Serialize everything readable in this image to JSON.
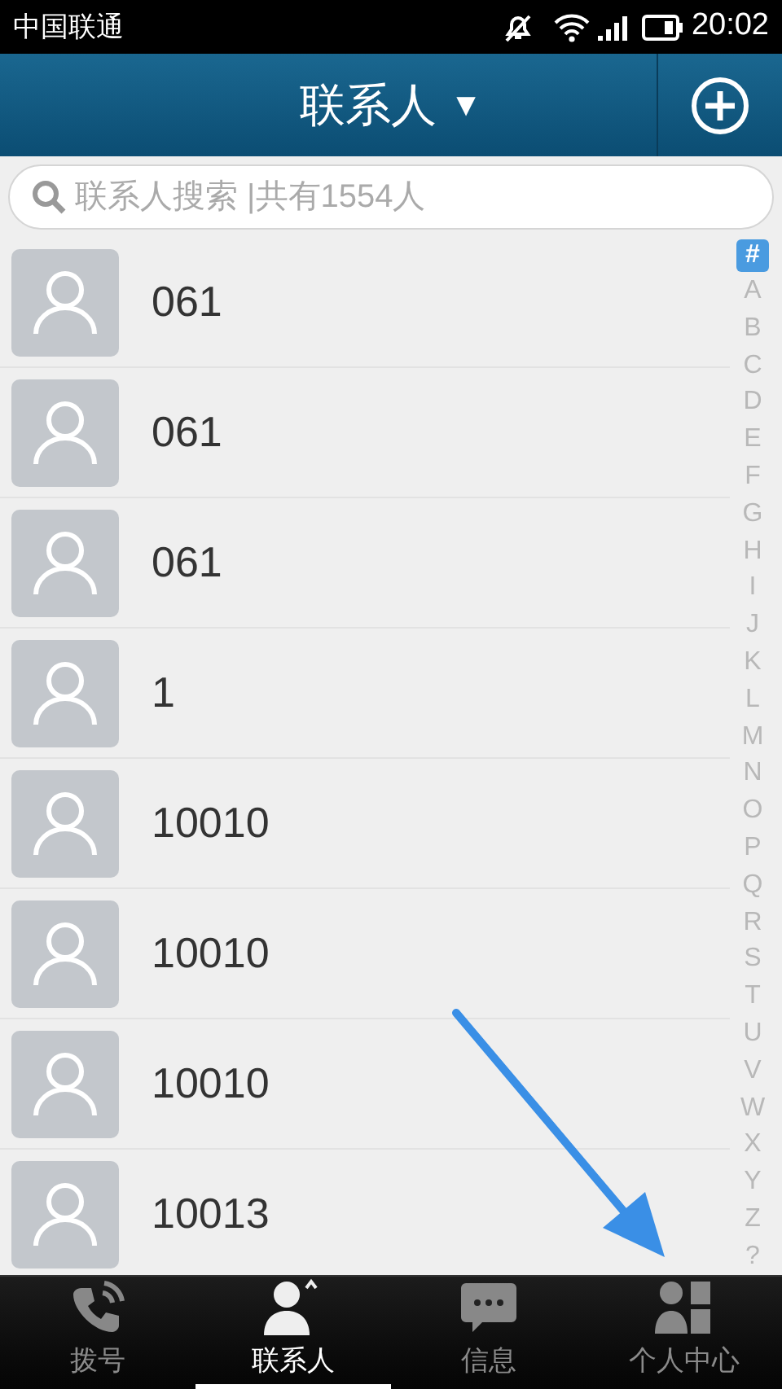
{
  "status_bar": {
    "carrier": "中国联通",
    "time": "20:02"
  },
  "header": {
    "title": "联系人",
    "dropdown": "▼"
  },
  "search": {
    "placeholder": "联系人搜索 |共有1554人"
  },
  "contacts": [
    {
      "name": "061"
    },
    {
      "name": "061"
    },
    {
      "name": "061"
    },
    {
      "name": "1"
    },
    {
      "name": "10010"
    },
    {
      "name": "10010"
    },
    {
      "name": "10010"
    },
    {
      "name": "10013"
    }
  ],
  "index": [
    {
      "label": "#",
      "selected": true
    },
    {
      "label": "A",
      "selected": false
    },
    {
      "label": "B",
      "selected": false
    },
    {
      "label": "C",
      "selected": false
    },
    {
      "label": "D",
      "selected": false
    },
    {
      "label": "E",
      "selected": false
    },
    {
      "label": "F",
      "selected": false
    },
    {
      "label": "G",
      "selected": false
    },
    {
      "label": "H",
      "selected": false
    },
    {
      "label": "I",
      "selected": false
    },
    {
      "label": "J",
      "selected": false
    },
    {
      "label": "K",
      "selected": false
    },
    {
      "label": "L",
      "selected": false
    },
    {
      "label": "M",
      "selected": false
    },
    {
      "label": "N",
      "selected": false
    },
    {
      "label": "O",
      "selected": false
    },
    {
      "label": "P",
      "selected": false
    },
    {
      "label": "Q",
      "selected": false
    },
    {
      "label": "R",
      "selected": false
    },
    {
      "label": "S",
      "selected": false
    },
    {
      "label": "T",
      "selected": false
    },
    {
      "label": "U",
      "selected": false
    },
    {
      "label": "V",
      "selected": false
    },
    {
      "label": "W",
      "selected": false
    },
    {
      "label": "X",
      "selected": false
    },
    {
      "label": "Y",
      "selected": false
    },
    {
      "label": "Z",
      "selected": false
    },
    {
      "label": "?",
      "selected": false
    }
  ],
  "tabs": [
    {
      "kind": "dial",
      "label": "拨号",
      "selected": false
    },
    {
      "kind": "contacts",
      "label": "联系人",
      "selected": true
    },
    {
      "kind": "messages",
      "label": "信息",
      "selected": false
    },
    {
      "kind": "profile",
      "label": "个人中心",
      "selected": false
    }
  ]
}
